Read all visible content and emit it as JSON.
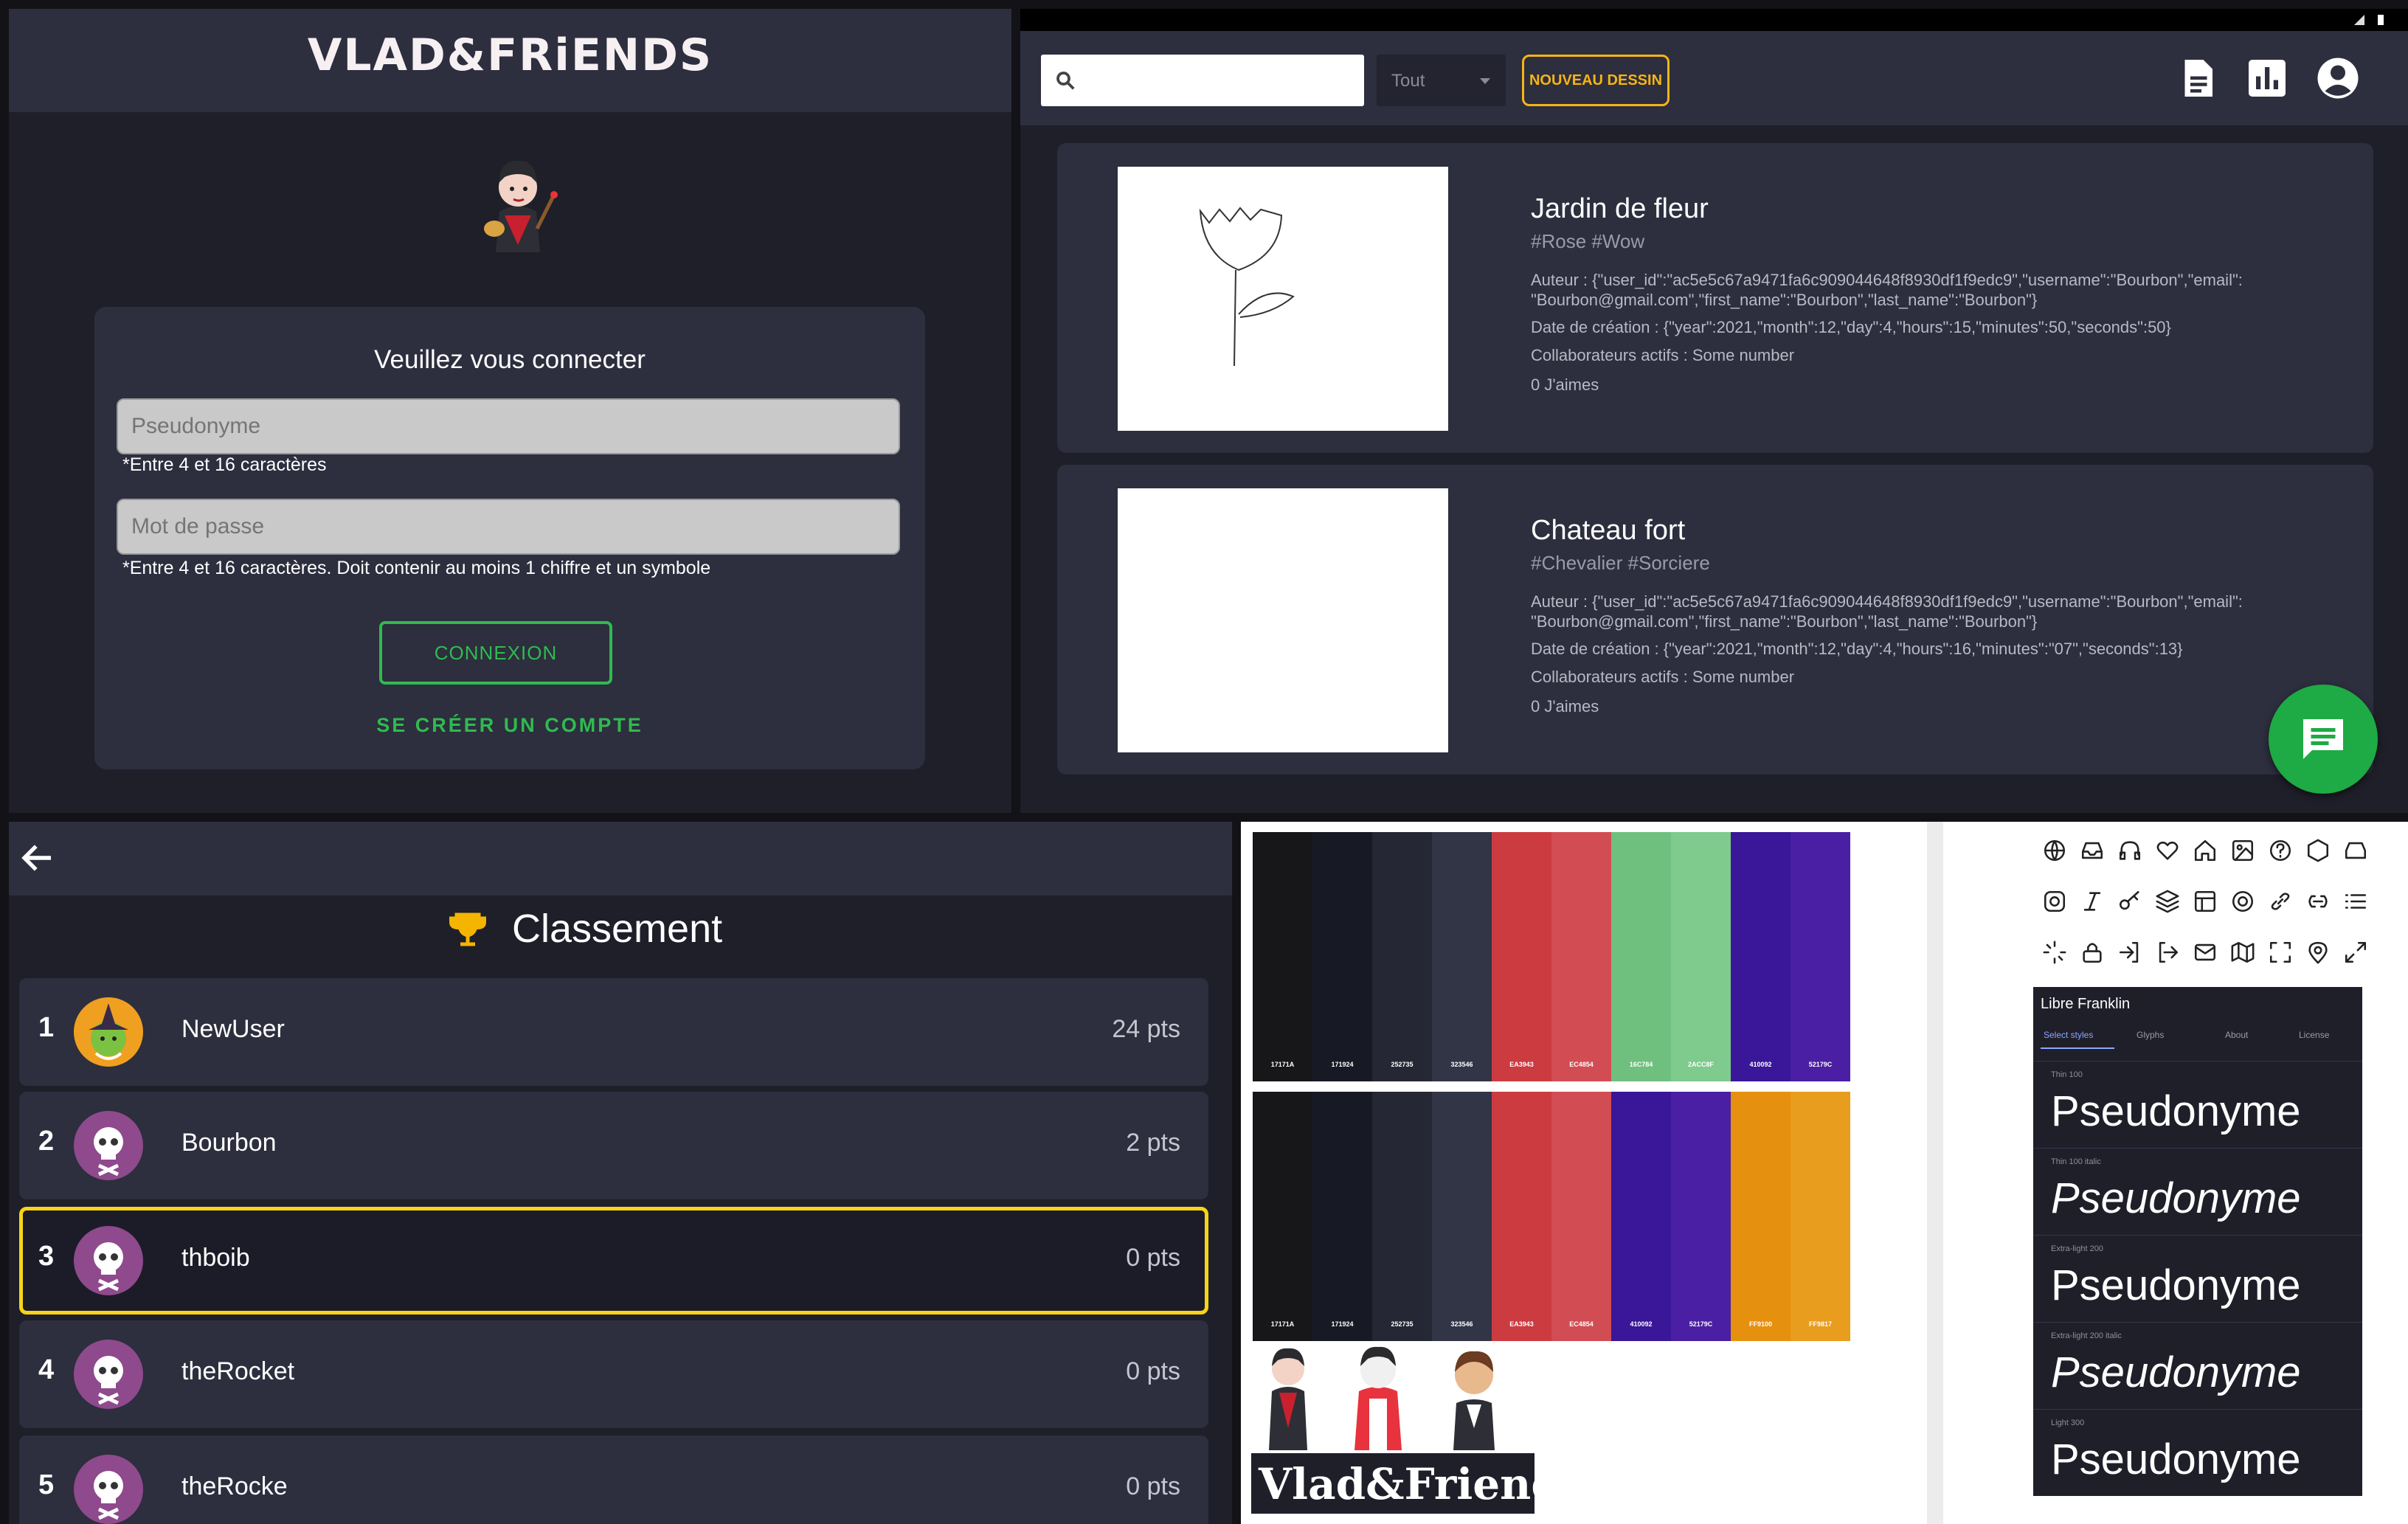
{
  "login": {
    "brand": "VLAD&FRiENDS",
    "title": "Veuillez vous connecter",
    "username_placeholder": "Pseudonyme",
    "username_hint": "*Entre 4 et 16 caractères",
    "password_placeholder": "Mot de passe",
    "password_hint": "*Entre 4 et 16 caractères. Doit contenir au moins 1 chiffre et un symbole",
    "connect_label": "CONNEXION",
    "create_account_label": "SE CRÉER UN COMPTE",
    "colors": {
      "accent": "#2fbb4f",
      "background": "#1e1f29",
      "card": "#2d2e3e"
    }
  },
  "gallery": {
    "search_placeholder": "",
    "filter_value": "Tout",
    "new_drawing_label": "NOUVEAU DESSIN",
    "icons": [
      "document-icon",
      "chart-icon",
      "account-icon",
      "chat-icon"
    ],
    "drawings": [
      {
        "title": "Jardin de fleur",
        "tags": "#Rose #Wow",
        "author": "Auteur : {\"user_id\":\"ac5e5c67a9471fa6c909044648f8930df1f9edc9\",\"username\":\"Bourbon\",\"email\": \"Bourbon@gmail.com\",\"first_name\":\"Bourbon\",\"last_name\":\"Bourbon\"}",
        "created": "Date de création : {\"year\":2021,\"month\":12,\"day\":4,\"hours\":15,\"minutes\":50,\"seconds\":50}",
        "collaborators": "Collaborateurs actifs : Some number",
        "likes": "0 J'aimes"
      },
      {
        "title": "Chateau fort",
        "tags": "#Chevalier #Sorciere",
        "author": "Auteur : {\"user_id\":\"ac5e5c67a9471fa6c909044648f8930df1f9edc9\",\"username\":\"Bourbon\",\"email\": \"Bourbon@gmail.com\",\"first_name\":\"Bourbon\",\"last_name\":\"Bourbon\"}",
        "created": "Date de création : {\"year\":2021,\"month\":12,\"day\":4,\"hours\":16,\"minutes\":\"07\",\"seconds\":13}",
        "collaborators": "Collaborateurs actifs : Some number",
        "likes": "0 J'aimes"
      }
    ],
    "colors": {
      "accent": "#f5b515",
      "fab": "#1eaa44"
    }
  },
  "leaderboard": {
    "title": "Classement",
    "entries": [
      {
        "rank": "1",
        "username": "NewUser",
        "points": "24 pts",
        "avatar": "witch-avatar-icon"
      },
      {
        "rank": "2",
        "username": "Bourbon",
        "points": "2 pts",
        "avatar": "skull-avatar-icon"
      },
      {
        "rank": "3",
        "username": "thboib",
        "points": "0 pts",
        "avatar": "skull-avatar-icon",
        "highlighted": true
      },
      {
        "rank": "4",
        "username": "theRocket",
        "points": "0 pts",
        "avatar": "skull-avatar-icon"
      },
      {
        "rank": "5",
        "username": "theRocke",
        "points": "0 pts",
        "avatar": "skull-avatar-icon"
      }
    ],
    "colors": {
      "highlight": "#f7d417",
      "avatar_bg": "#8e4a8c"
    }
  },
  "design": {
    "palette_top": [
      {
        "code": "17171A",
        "color": "#17171a"
      },
      {
        "code": "171924",
        "color": "#171924"
      },
      {
        "code": "252735",
        "color": "#252735"
      },
      {
        "code": "323546",
        "color": "#323546"
      },
      {
        "code": "EA3943",
        "color": "#cc3b40"
      },
      {
        "code": "EC4854",
        "color": "#d24d53"
      },
      {
        "code": "16C784",
        "color": "#6fc07f"
      },
      {
        "code": "2ACC8F",
        "color": "#7ecb8d"
      },
      {
        "code": "410092",
        "color": "#3a1698"
      },
      {
        "code": "52179C",
        "color": "#4b1fa3"
      }
    ],
    "palette_bottom": [
      {
        "code": "17171A",
        "color": "#17171a"
      },
      {
        "code": "171924",
        "color": "#171924"
      },
      {
        "code": "252735",
        "color": "#252735"
      },
      {
        "code": "323546",
        "color": "#323546"
      },
      {
        "code": "EA3943",
        "color": "#cc3b40"
      },
      {
        "code": "EC4854",
        "color": "#d24d53"
      },
      {
        "code": "410092",
        "color": "#3a1698"
      },
      {
        "code": "52179C",
        "color": "#4b1fa3"
      },
      {
        "code": "FF9100",
        "color": "#e6900f"
      },
      {
        "code": "FF9817",
        "color": "#e89d1f"
      }
    ],
    "logo_text": "Vlad&Friends",
    "font_name": "Libre Franklin",
    "font_tabs": [
      "Select styles",
      "Glyphs",
      "About",
      "License"
    ],
    "font_samples": [
      {
        "style": "Thin 100",
        "text": "Pseudonyme",
        "italic": false
      },
      {
        "style": "Thin 100 italic",
        "text": "Pseudonyme",
        "italic": true
      },
      {
        "style": "Extra-light 200",
        "text": "Pseudonyme",
        "italic": false
      },
      {
        "style": "Extra-light 200 italic",
        "text": "Pseudonyme",
        "italic": true
      },
      {
        "style": "Light 300",
        "text": "Pseudonyme",
        "italic": false
      }
    ],
    "icon_grid": [
      "globe-icon",
      "inbox-icon",
      "headphones-icon",
      "heart-icon",
      "home-icon",
      "image-icon",
      "help-icon",
      "hexagon-icon",
      "mail-tray-icon",
      "instagram-icon",
      "italic-icon",
      "key-icon",
      "layers-icon",
      "layout-icon",
      "lifebuoy-icon",
      "link-icon",
      "link-2-icon",
      "list-icon",
      "loader-icon",
      "lock-icon",
      "log-in-icon",
      "log-out-icon",
      "mail-icon",
      "map-icon",
      "maximize-icon",
      "map-pin-icon",
      "maximize-2-icon"
    ]
  }
}
